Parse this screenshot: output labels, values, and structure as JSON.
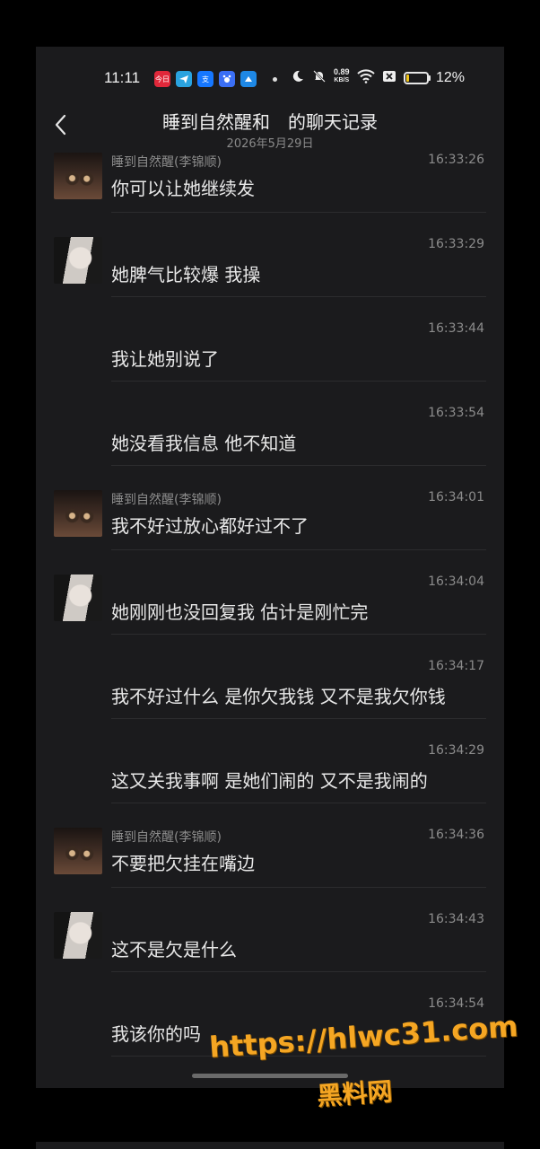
{
  "status_bar": {
    "time": "11:11",
    "net_speed_value": "0.89",
    "net_speed_unit": "KB/S",
    "battery_percent": "12%",
    "battery_level": 0.12,
    "app_icons": [
      "news-app-icon",
      "telegram-icon",
      "alipay-icon",
      "baidu-icon",
      "browser-icon"
    ],
    "app_icon_labels": [
      "今日",
      "",
      "支",
      "",
      ""
    ]
  },
  "header": {
    "title": "睡到自然醒和　的聊天记录",
    "date": "2026年5月29日"
  },
  "messages": [
    {
      "avatar": "male",
      "sender": "睡到自然醒(李锦顺)",
      "time": "16:33:26",
      "text": "你可以让她继续发"
    },
    {
      "avatar": "female",
      "sender": "",
      "time": "16:33:29",
      "text": "她脾气比较爆 我操"
    },
    {
      "avatar": "",
      "sender": "",
      "time": "16:33:44",
      "text": "我让她别说了"
    },
    {
      "avatar": "",
      "sender": "",
      "time": "16:33:54",
      "text": "她没看我信息 他不知道"
    },
    {
      "avatar": "male",
      "sender": "睡到自然醒(李锦顺)",
      "time": "16:34:01",
      "text": "我不好过放心都好过不了"
    },
    {
      "avatar": "female",
      "sender": "",
      "time": "16:34:04",
      "text": "她刚刚也没回复我 估计是刚忙完"
    },
    {
      "avatar": "",
      "sender": "",
      "time": "16:34:17",
      "text": "我不好过什么 是你欠我钱 又不是我欠你钱"
    },
    {
      "avatar": "",
      "sender": "",
      "time": "16:34:29",
      "text": "这又关我事啊 是她们闹的 又不是我闹的"
    },
    {
      "avatar": "male",
      "sender": "睡到自然醒(李锦顺)",
      "time": "16:34:36",
      "text": "不要把欠挂在嘴边"
    },
    {
      "avatar": "female",
      "sender": "",
      "time": "16:34:43",
      "text": "这不是欠是什么"
    },
    {
      "avatar": "",
      "sender": "",
      "time": "16:34:54",
      "text": "我该你的吗"
    }
  ],
  "watermark": {
    "url": "https://hlwc31.com",
    "name": "黑料网"
  },
  "colors": {
    "background": "#1b1b1d",
    "text": "#e8e8e8",
    "muted": "#8c8c8c",
    "watermark": "#f5a623",
    "battery": "#f0c419"
  }
}
